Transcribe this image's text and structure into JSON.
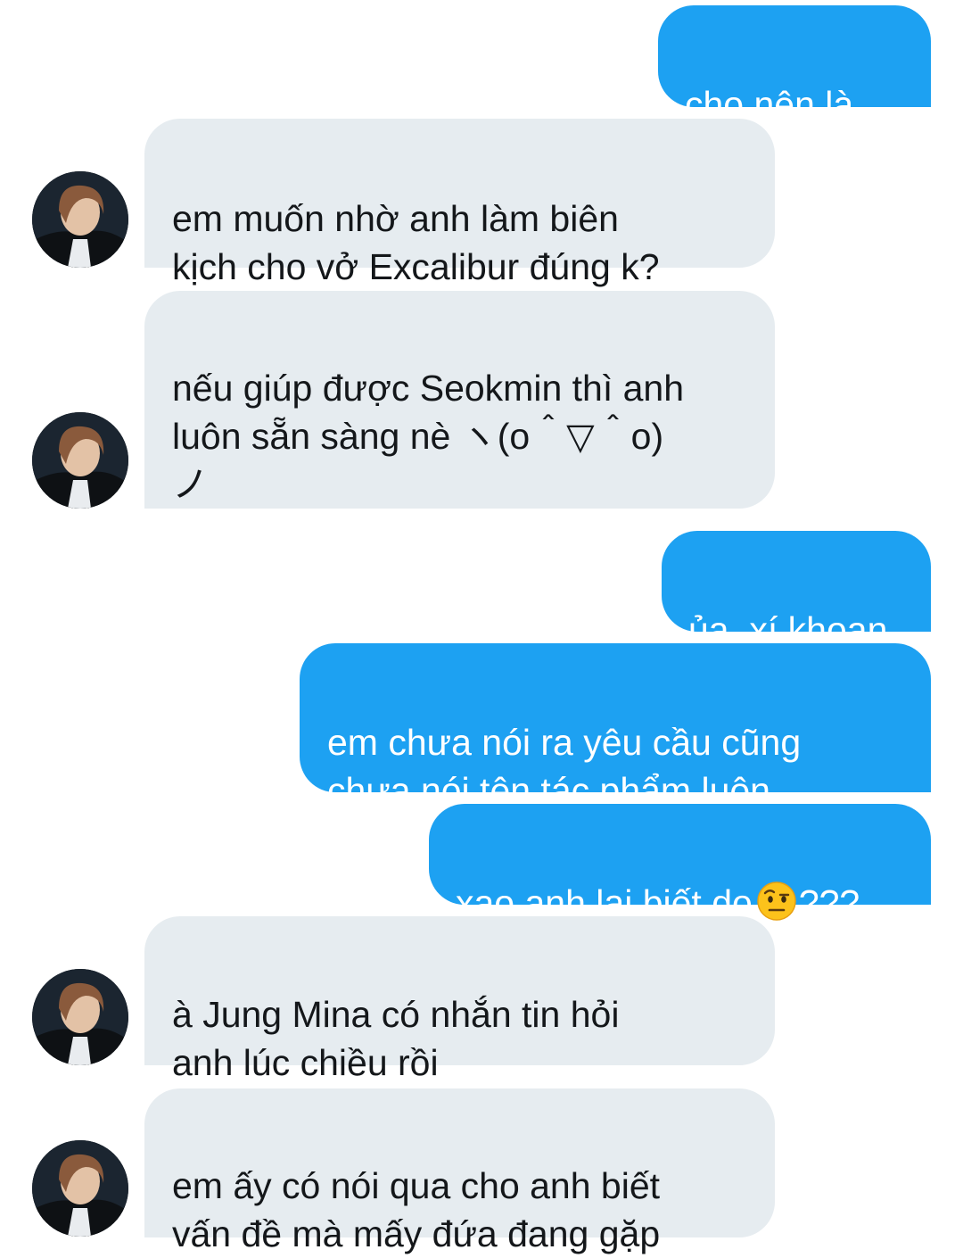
{
  "conversation": {
    "messages": [
      {
        "side": "out",
        "text": "cho nên là..."
      },
      {
        "side": "in",
        "text": "em muốn nhờ anh làm biên\nkịch cho vở Excalibur đúng k?"
      },
      {
        "side": "in",
        "text": "nếu giúp được Seokmin thì anh\nluôn sẵn sàng nè ヽ(o＾▽＾o)\nノ"
      },
      {
        "side": "out",
        "text": "ủa, xí khoan"
      },
      {
        "side": "out",
        "text": "em chưa nói ra yêu cầu cũng\nchưa nói tên tác phẩm luôn"
      },
      {
        "side": "out",
        "text_before": "xao anh lại biết dọ",
        "emoji": "raised-eyebrow-emoji",
        "text_after": "???"
      },
      {
        "side": "in",
        "text": "à Jung Mina có nhắn tin hỏi\nanh lúc chiều rồi"
      },
      {
        "side": "in",
        "text": "em ấy có nói qua cho anh biết\nvấn đề mà mấy đứa đang gặp"
      }
    ],
    "avatar_icon": "contact-avatar-photo",
    "colors": {
      "outgoing_bubble": "#1da1f2",
      "incoming_bubble": "#e6ecf0",
      "outgoing_text": "#ffffff",
      "incoming_text": "#14171a",
      "background": "#ffffff"
    }
  }
}
